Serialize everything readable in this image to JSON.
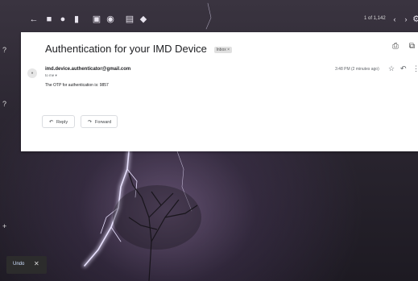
{
  "toolbar": {
    "back_icon": "arrow-left-icon",
    "icons": [
      "archive-icon",
      "report-spam-icon",
      "delete-icon",
      "mark-unread-icon",
      "snooze-icon",
      "move-to-icon",
      "label-icon"
    ],
    "page_count": "1 of 1,142"
  },
  "email": {
    "subject": "Authentication for your IMD Device",
    "label_chip": "Inbox ×",
    "sender": "imd.device.authenticator@gmail.com",
    "to": "to me ▾",
    "time": "3:48 PM (2 minutes ago)",
    "body": "The OTP for authentication is: 9857"
  },
  "actions": {
    "reply_label": "Reply",
    "forward_label": "Forward"
  },
  "snackbar": {
    "undo_label": "Undo",
    "close_label": "✕"
  },
  "colors": {
    "card_bg": "#ffffff",
    "text_primary": "#202124",
    "text_secondary": "#5f6368"
  }
}
